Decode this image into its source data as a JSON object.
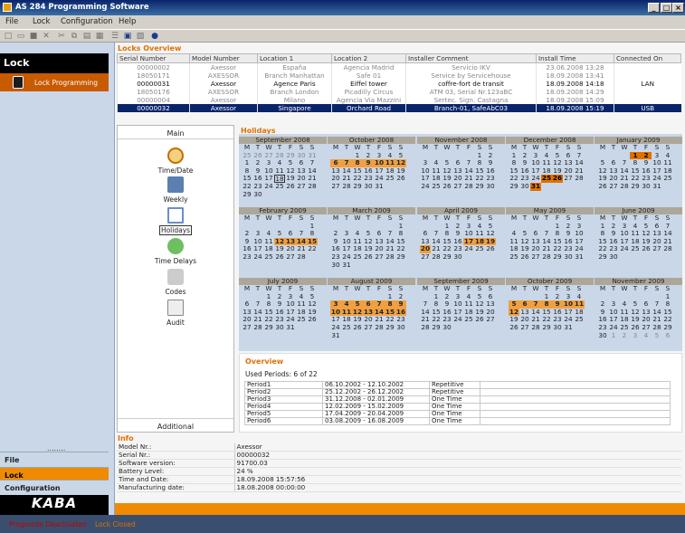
{
  "app": {
    "title": "AS 284 Programming Software"
  },
  "menu": [
    "File",
    "Lock",
    "Configuration",
    "Help"
  ],
  "left": {
    "title": "Lock",
    "item": "Lock Programming",
    "nav": [
      "File",
      "Lock",
      "Configuration"
    ],
    "logo": "KABA"
  },
  "locks": {
    "title": "Locks Overview",
    "columns": [
      "Serial Number",
      "Model Number",
      "Location 1",
      "Location 2",
      "Installer Comment",
      "Install Time",
      "Connected On"
    ],
    "rows": [
      [
        "00000002",
        "Axessor",
        "España",
        "Agencia Madrid",
        "Servicio IKV",
        "23.06.2008 13:28",
        ""
      ],
      [
        "18050171",
        "AXESSOR",
        "Branch Manhattan",
        "Safe 01",
        "Service by Servicehouse",
        "18.09.2008 13:41",
        ""
      ],
      [
        "00000031",
        "Axessor",
        "Agence Paris",
        "Eiffel tower",
        "coffre-fort de transit",
        "18.09.2008 14:18",
        "LAN"
      ],
      [
        "18050176",
        "AXESSOR",
        "Branch London",
        "Picadilly Circus",
        "ATM 03, Serial Nr.123aBC",
        "18.09.2008 14:29",
        ""
      ],
      [
        "00000004",
        "Axessor",
        "Milano",
        "Agencia Via Mazzini",
        "Sertec. Sign. Castagna",
        "18.09.2008 15:09",
        ""
      ],
      [
        "00000032",
        "Axessor",
        "Singapore",
        "Orchard Road",
        "Branch-01, SafeAbC03",
        "18.09.2008 15:19",
        "USB"
      ]
    ]
  },
  "tabs": {
    "head": "Main",
    "items": [
      "Time/Date",
      "Weekly",
      "Holidays",
      "Time Delays",
      "Codes",
      "Audit"
    ],
    "foot": "Additional"
  },
  "holidays": {
    "title": "Holidays",
    "weekdays": "M T W T F S S"
  },
  "overview": {
    "title": "Overview",
    "used": "Used Periods: 6 of 22",
    "rows": [
      [
        "Period1",
        "06.10.2002 - 12.10.2002",
        "Repetitive"
      ],
      [
        "Period2",
        "25.12.2002 - 26.12.2002",
        "Repetitive"
      ],
      [
        "Period3",
        "31.12.2008 - 02.01.2009",
        "One Time"
      ],
      [
        "Period4",
        "12.02.2009 - 15.02.2009",
        "One Time"
      ],
      [
        "Period5",
        "17.04.2009 - 20.04.2009",
        "One Time"
      ],
      [
        "Period6",
        "03.08.2009 - 16.08.2009",
        "One Time"
      ]
    ]
  },
  "info": {
    "title": "Info",
    "rows": [
      [
        "Model Nr.:",
        "Axessor"
      ],
      [
        "Serial Nr.:",
        "00000032"
      ],
      [
        "Software version:",
        "91700.03"
      ],
      [
        "Battery Level:",
        "24 %"
      ],
      [
        "Time and Date:",
        "18.09.2008 15:57:56"
      ],
      [
        "Manufacturing date:",
        "18.08.2008 00:00:00"
      ]
    ]
  },
  "status": {
    "left": "Progmode Deactivated",
    "right": "Lock Closed"
  },
  "months": [
    {
      "name": "September 2008",
      "off": 0,
      "days": 30,
      "prev": [
        25,
        26,
        27,
        28,
        29,
        30,
        31
      ],
      "hl": [],
      "today": 18
    },
    {
      "name": "October 2008",
      "off": 2,
      "days": 31,
      "hl": [
        6,
        7,
        8,
        9,
        10,
        11,
        12
      ]
    },
    {
      "name": "November 2008",
      "off": 5,
      "days": 30,
      "hl": []
    },
    {
      "name": "December 2008",
      "off": 0,
      "days": 31,
      "hl": [
        25,
        26,
        31
      ]
    },
    {
      "name": "January 2009",
      "off": 3,
      "days": 31,
      "hl": [
        1,
        2
      ]
    },
    {
      "name": "February 2009",
      "off": 6,
      "days": 28,
      "hl": [
        12,
        13,
        14,
        15
      ]
    },
    {
      "name": "March 2009",
      "off": 6,
      "days": 31,
      "hl": []
    },
    {
      "name": "April 2009",
      "off": 2,
      "days": 30,
      "hl": [
        17,
        18,
        19,
        20
      ]
    },
    {
      "name": "May 2009",
      "off": 4,
      "days": 31,
      "hl": []
    },
    {
      "name": "June 2009",
      "off": 0,
      "days": 30,
      "hl": []
    },
    {
      "name": "July 2009",
      "off": 2,
      "days": 31,
      "hl": []
    },
    {
      "name": "August 2009",
      "off": 5,
      "days": 31,
      "hl": [
        3,
        4,
        5,
        6,
        7,
        8,
        9,
        10,
        11,
        12,
        13,
        14,
        15,
        16
      ]
    },
    {
      "name": "September 2009",
      "off": 1,
      "days": 30,
      "hl": []
    },
    {
      "name": "October 2009",
      "off": 3,
      "days": 31,
      "hl": [
        5,
        6,
        7,
        8,
        9,
        10,
        11,
        12
      ]
    },
    {
      "name": "November 2009",
      "off": 6,
      "days": 30,
      "next": [
        1,
        2,
        3,
        4,
        5,
        6
      ],
      "hl": []
    }
  ]
}
